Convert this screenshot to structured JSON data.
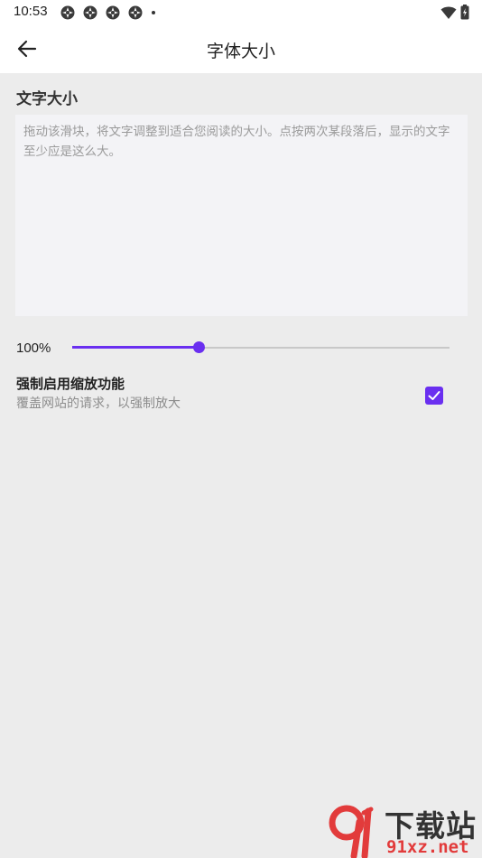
{
  "status_bar": {
    "time": "10:53",
    "notification_icons": [
      "sync-icon",
      "sync-icon",
      "sync-icon",
      "sync-icon"
    ],
    "right_icons": [
      "wifi-icon",
      "battery-icon"
    ]
  },
  "app_bar": {
    "title": "字体大小",
    "back_icon": "arrow-left-icon"
  },
  "text_size": {
    "section_title": "文字大小",
    "preview_text": "拖动该滑块，将文字调整到适合您阅读的大小。点按两次某段落后，显示的文字至少应是这么大。",
    "percent_label": "100%",
    "slider_value": 0.335
  },
  "force_zoom": {
    "title": "强制启用缩放功能",
    "description": "覆盖网站的请求，以强制放大",
    "checked": true
  },
  "watermark": {
    "logo_text": "91",
    "title": "下载站",
    "url": "91xz.net"
  },
  "colors": {
    "accent": "#6a2ff0",
    "background": "#ececec",
    "surface": "#ffffff",
    "preview_bg": "#f3f3f6",
    "watermark_red": "#e23b3b"
  }
}
